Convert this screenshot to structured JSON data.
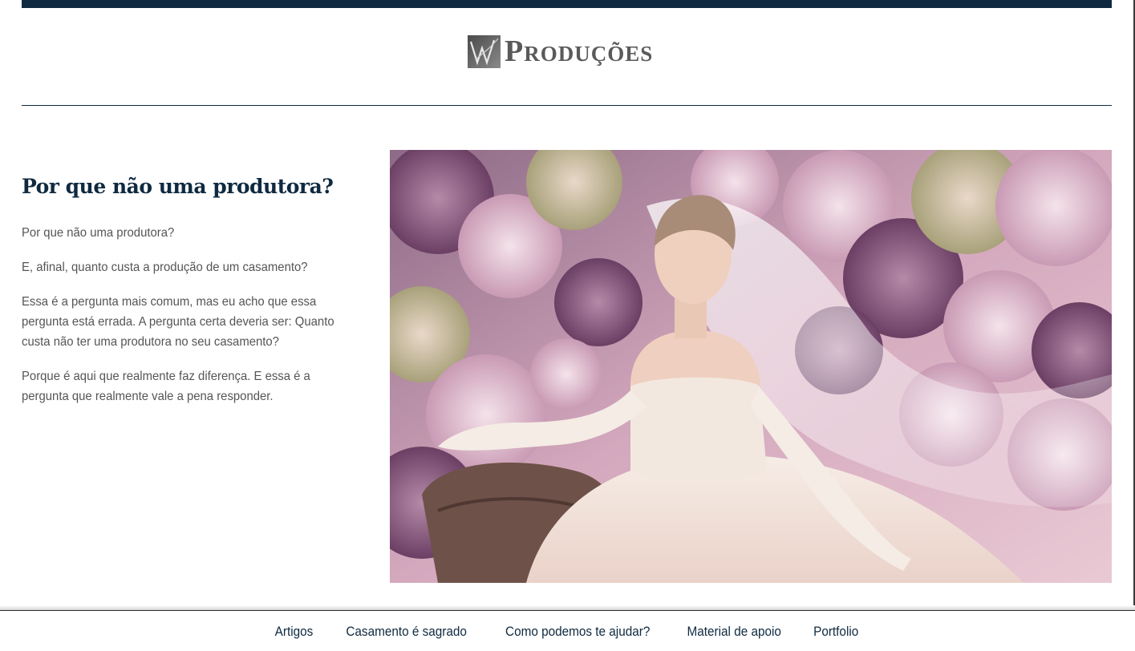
{
  "header": {
    "logo_text": "Produções",
    "logo_mark_icon": "w-monogram-icon",
    "accent_color": "#0f2a40"
  },
  "article": {
    "title": "Por que não uma produtora?",
    "paragraphs": [
      "Por que não uma produtora?",
      "E, afinal, quanto custa a produção de um casamento?",
      "Essa é a pergunta mais comum, mas eu acho que essa pergunta está errada. A pergunta certa deveria ser: Quanto custa não ter uma produtora no seu casamento?",
      "Porque é aqui que realmente faz diferença. E essa é a pergunta que realmente vale a pena responder."
    ]
  },
  "hero_image": {
    "subject": "bride-among-flowers-photo"
  },
  "footer": {
    "nav": [
      {
        "label": "Artigos"
      },
      {
        "label": "Casamento é sagrado"
      },
      {
        "label": "Como podemos te ajudar?"
      },
      {
        "label": "Material de apoio"
      },
      {
        "label": "Portfolio"
      }
    ]
  }
}
